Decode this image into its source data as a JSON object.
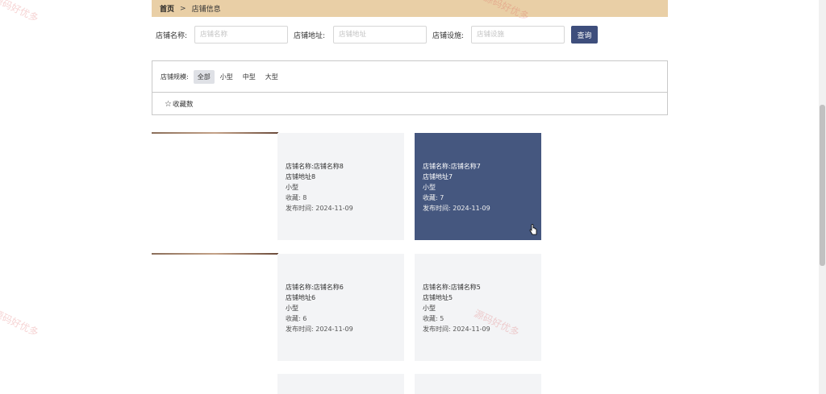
{
  "breadcrumb": {
    "home": "首页",
    "separator": ">",
    "current": "店铺信息"
  },
  "search": {
    "name_label": "店铺名称:",
    "name_placeholder": "店铺名称",
    "address_label": "店铺地址:",
    "address_placeholder": "店铺地址",
    "facility_label": "店铺设施:",
    "facility_placeholder": "店铺设施",
    "button_label": "查询"
  },
  "filter": {
    "label": "店铺规模:",
    "options": [
      "全部",
      "小型",
      "中型",
      "大型"
    ],
    "active": "全部"
  },
  "sort": {
    "star_icon": "star-outline-icon",
    "label": "收藏数"
  },
  "cards": [
    {
      "name": "店铺名称:店铺名称8",
      "address": "店铺地址8",
      "size": "小型",
      "favorites": "收藏:  8",
      "published": "发布时间:  2024-11-09"
    },
    {
      "name": "店铺名称:店铺名称7",
      "address": "店铺地址7",
      "size": "小型",
      "favorites": "收藏:  7",
      "published": "发布时间:  2024-11-09"
    },
    {
      "name": "店铺名称:店铺名称6",
      "address": "店铺地址6",
      "size": "小型",
      "favorites": "收藏:  6",
      "published": "发布时间:  2024-11-09"
    },
    {
      "name": "店铺名称:店铺名称5",
      "address": "店铺地址5",
      "size": "小型",
      "favorites": "收藏:  5",
      "published": "发布时间:  2024-11-09"
    }
  ],
  "watermark": "源码好优多",
  "colors": {
    "breadcrumb_bg": "#e9cfa6",
    "primary": "#3e4e7c",
    "highlight_card": "#45577f",
    "card_bg": "#f3f4f6"
  }
}
